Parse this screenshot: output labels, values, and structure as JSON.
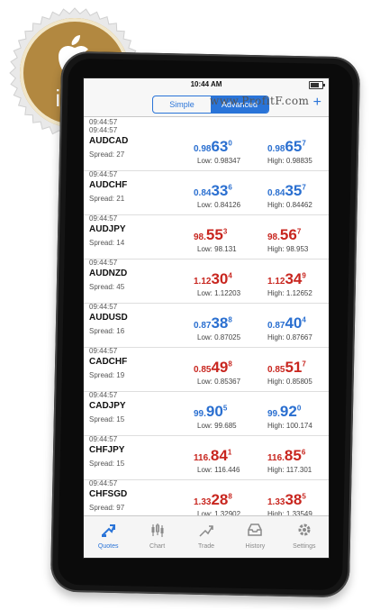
{
  "badge": {
    "text": "iOS",
    "icon": "apple-logo-icon",
    "color": "#b28840"
  },
  "statusbar": {
    "time": "10:44 AM"
  },
  "navbar": {
    "segments": [
      "Simple",
      "Advanced"
    ],
    "active_segment": "Advanced",
    "watermark": "www.ProfitF.com",
    "add_label": "+"
  },
  "colors": {
    "up": "#2a6fd0",
    "down": "#c8261f",
    "accent": "#2a74d8"
  },
  "header_time": "09:44:57",
  "quotes": [
    {
      "time": "09:44:57",
      "symbol": "AUDCAD",
      "spread": "Spread: 27",
      "direction": "blue",
      "bid": {
        "small": "0.98",
        "big": "63",
        "sup": "0"
      },
      "low": "Low: 0.98347",
      "ask": {
        "small": "0.98",
        "big": "65",
        "sup": "7"
      },
      "high": "High: 0.98835"
    },
    {
      "time": "09:44:57",
      "symbol": "AUDCHF",
      "spread": "Spread: 21",
      "direction": "blue",
      "bid": {
        "small": "0.84",
        "big": "33",
        "sup": "6"
      },
      "low": "Low: 0.84126",
      "ask": {
        "small": "0.84",
        "big": "35",
        "sup": "7"
      },
      "high": "High: 0.84462"
    },
    {
      "time": "09:44:57",
      "symbol": "AUDJPY",
      "spread": "Spread: 14",
      "direction": "red",
      "bid": {
        "small": "98.",
        "big": "55",
        "sup": "3"
      },
      "low": "Low: 98.131",
      "ask": {
        "small": "98.",
        "big": "56",
        "sup": "7"
      },
      "high": "High: 98.953"
    },
    {
      "time": "09:44:57",
      "symbol": "AUDNZD",
      "spread": "Spread: 45",
      "direction": "red",
      "bid": {
        "small": "1.12",
        "big": "30",
        "sup": "4"
      },
      "low": "Low: 1.12203",
      "ask": {
        "small": "1.12",
        "big": "34",
        "sup": "9"
      },
      "high": "High: 1.12652"
    },
    {
      "time": "09:44:57",
      "symbol": "AUDUSD",
      "spread": "Spread: 16",
      "direction": "blue",
      "bid": {
        "small": "0.87",
        "big": "38",
        "sup": "8"
      },
      "low": "Low: 0.87025",
      "ask": {
        "small": "0.87",
        "big": "40",
        "sup": "4"
      },
      "high": "High: 0.87667"
    },
    {
      "time": "09:44:57",
      "symbol": "CADCHF",
      "spread": "Spread: 19",
      "direction": "red",
      "bid": {
        "small": "0.85",
        "big": "49",
        "sup": "8"
      },
      "low": "Low: 0.85367",
      "ask": {
        "small": "0.85",
        "big": "51",
        "sup": "7"
      },
      "high": "High: 0.85805"
    },
    {
      "time": "09:44:57",
      "symbol": "CADJPY",
      "spread": "Spread: 15",
      "direction": "blue",
      "bid": {
        "small": "99.",
        "big": "90",
        "sup": "5"
      },
      "low": "Low: 99.685",
      "ask": {
        "small": "99.",
        "big": "92",
        "sup": "0"
      },
      "high": "High: 100.174"
    },
    {
      "time": "09:44:57",
      "symbol": "CHFJPY",
      "spread": "Spread: 15",
      "direction": "red",
      "bid": {
        "small": "116.",
        "big": "84",
        "sup": "1"
      },
      "low": "Low: 116.446",
      "ask": {
        "small": "116.",
        "big": "85",
        "sup": "6"
      },
      "high": "High: 117.301"
    },
    {
      "time": "09:44:57",
      "symbol": "CHFSGD",
      "spread": "Spread: 97",
      "direction": "red",
      "bid": {
        "small": "1.33",
        "big": "28",
        "sup": "8"
      },
      "low": "Low: 1.32902",
      "ask": {
        "small": "1.33",
        "big": "38",
        "sup": "5"
      },
      "high": "High: 1.33549"
    }
  ],
  "tabs": [
    {
      "label": "Quotes",
      "icon": "quotes-icon",
      "active": true
    },
    {
      "label": "Chart",
      "icon": "chart-icon",
      "active": false
    },
    {
      "label": "Trade",
      "icon": "trade-icon",
      "active": false
    },
    {
      "label": "History",
      "icon": "history-icon",
      "active": false
    },
    {
      "label": "Settings",
      "icon": "settings-icon",
      "active": false
    }
  ]
}
